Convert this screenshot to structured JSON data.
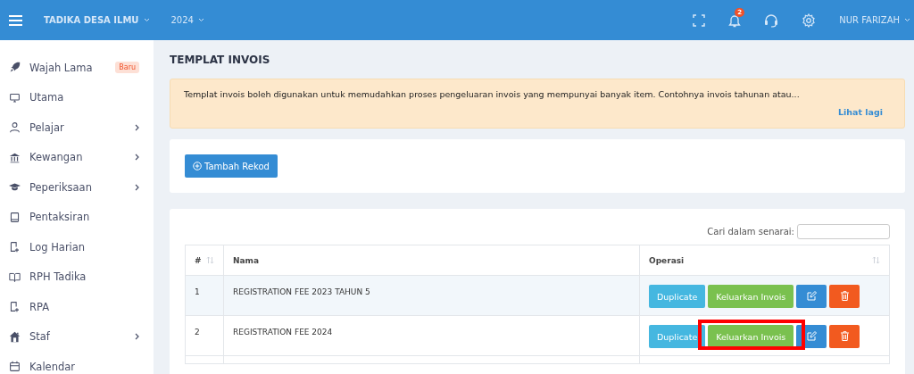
{
  "header": {
    "school": "TADIKA DESA ILMU",
    "year": "2024",
    "notifications": "2",
    "user": "NUR FARIZAH"
  },
  "sidebar": {
    "items": [
      {
        "label": "Wajah Lama",
        "badge": "Baru",
        "expandable": false
      },
      {
        "label": "Utama",
        "expandable": false
      },
      {
        "label": "Pelajar",
        "expandable": true
      },
      {
        "label": "Kewangan",
        "expandable": true
      },
      {
        "label": "Peperiksaan",
        "expandable": true
      },
      {
        "label": "Pentaksiran",
        "expandable": false
      },
      {
        "label": "Log Harian",
        "expandable": false
      },
      {
        "label": "RPH Tadika",
        "expandable": false
      },
      {
        "label": "RPA",
        "expandable": false
      },
      {
        "label": "Staf",
        "expandable": true
      },
      {
        "label": "Kalendar",
        "expandable": false
      }
    ]
  },
  "page": {
    "title": "TEMPLAT INVOIS",
    "notice": {
      "text": "Templat invois boleh digunakan untuk memudahkan proses pengeluaran invois yang mempunyai banyak item. Contohnya invois tahunan atau...",
      "link": "Lihat lagi"
    },
    "add_button": "Tambah Rekod",
    "search": {
      "label": "Cari dalam senarai:"
    },
    "table": {
      "columns": [
        {
          "label": "#",
          "sortable": true
        },
        {
          "label": "Nama",
          "sortable": false
        },
        {
          "label": "Operasi",
          "sortable": true
        }
      ],
      "rows": [
        {
          "no": "1",
          "name": "REGISTRATION FEE 2023 TAHUN 5",
          "duplicate": "Duplicate",
          "issue": "Keluarkan Invois",
          "highlighted": false
        },
        {
          "no": "2",
          "name": "REGISTRATION FEE 2024",
          "duplicate": "Duplicate",
          "issue": "Keluarkan Invois",
          "highlighted": true
        }
      ]
    }
  }
}
